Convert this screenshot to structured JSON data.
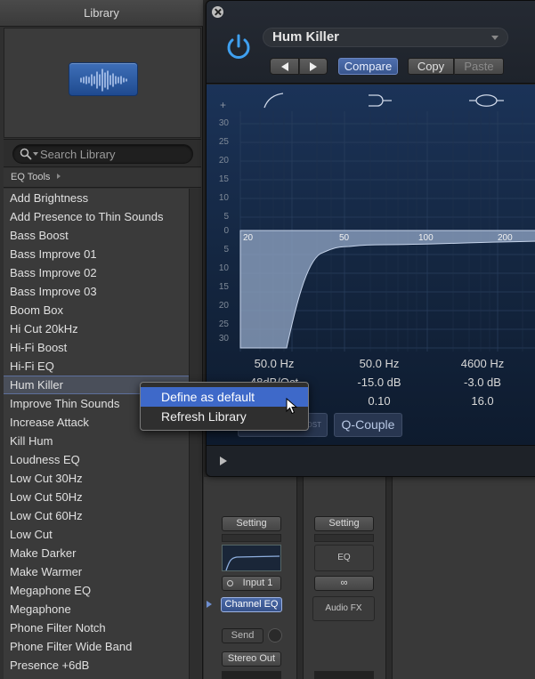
{
  "library": {
    "title": "Library",
    "search_placeholder": "Search Library",
    "breadcrumb": "EQ Tools",
    "items": [
      "Add Brightness",
      "Add Presence to Thin Sounds",
      "Bass Boost",
      "Bass Improve 01",
      "Bass Improve 02",
      "Bass Improve 03",
      "Boom Box",
      "Hi Cut 20kHz",
      "Hi-Fi Boost",
      "Hi-Fi EQ",
      "Hum Killer",
      "Improve Thin Sounds",
      "Increase Attack",
      "Kill Hum",
      "Loudness EQ",
      "Low Cut 30Hz",
      "Low Cut 50Hz",
      "Low Cut 60Hz",
      "Low Cut",
      "Make Darker",
      "Make Warmer",
      "Megaphone EQ",
      "Megaphone",
      "Phone Filter Notch",
      "Phone Filter Wide Band",
      "Presence +6dB"
    ],
    "selected_index": 10
  },
  "context_menu": {
    "items": [
      "Define as default",
      "Refresh Library"
    ],
    "highlighted_index": 0
  },
  "plugin": {
    "preset_name": "Hum Killer",
    "compare_label": "Compare",
    "copy_label": "Copy",
    "paste_label": "Paste",
    "db_scale": [
      "30",
      "25",
      "20",
      "15",
      "10",
      "5",
      "0",
      "5",
      "10",
      "15",
      "20",
      "25",
      "30"
    ],
    "plus_sign": "+",
    "freq_labels": [
      "20",
      "50",
      "100",
      "200"
    ],
    "bands": [
      {
        "freq": "50.0 Hz",
        "gain": "48dB/Oct",
        "q": ""
      },
      {
        "freq": "50.0 Hz",
        "gain": "-15.0 dB",
        "q": "0.10"
      },
      {
        "freq": "4600 Hz",
        "gain": "-3.0 dB",
        "q": "16.0"
      }
    ],
    "post_label": "OST",
    "q_couple_label": "Q-Couple",
    "colors": {
      "accent": "#3e69c9",
      "power": "#3fa0f0",
      "curve_fill": "#8ea3c2"
    }
  },
  "mixer": {
    "setting_label": "Setting",
    "input_label": "Input 1",
    "channel_eq_label": "Channel EQ",
    "send_label": "Send",
    "stereo_out_label": "Stereo Out",
    "eq_label": "EQ",
    "link_label": "∞",
    "audio_fx_label": "Audio FX"
  }
}
